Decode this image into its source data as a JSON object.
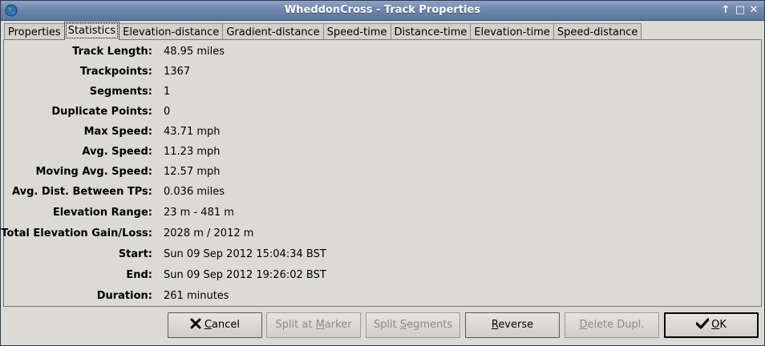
{
  "window": {
    "title": "WheddonCross - Track Properties",
    "controls": [
      "↑",
      "□",
      "✕"
    ]
  },
  "tabs": [
    {
      "label": "Properties"
    },
    {
      "label": "Statistics"
    },
    {
      "label": "Elevation-distance"
    },
    {
      "label": "Gradient-distance"
    },
    {
      "label": "Speed-time"
    },
    {
      "label": "Distance-time"
    },
    {
      "label": "Elevation-time"
    },
    {
      "label": "Speed-distance"
    }
  ],
  "active_tab": "Statistics",
  "stats": [
    {
      "label": "Track Length:",
      "value": "48.95 miles"
    },
    {
      "label": "Trackpoints:",
      "value": "1367"
    },
    {
      "label": "Segments:",
      "value": "1"
    },
    {
      "label": "Duplicate Points:",
      "value": "0"
    },
    {
      "label": "Max Speed:",
      "value": "43.71 mph"
    },
    {
      "label": "Avg. Speed:",
      "value": "11.23 mph"
    },
    {
      "label": "Moving Avg. Speed:",
      "value": "12.57 mph"
    },
    {
      "label": "Avg. Dist. Between TPs:",
      "value": "0.036 miles"
    },
    {
      "label": "Elevation Range:",
      "value": "23 m - 481 m"
    },
    {
      "label": "Total Elevation Gain/Loss:",
      "value": "2028 m / 2012 m"
    },
    {
      "label": "Start:",
      "value": "Sun 09 Sep 2012 15:04:34 BST"
    },
    {
      "label": "End:",
      "value": "Sun 09 Sep 2012 19:26:02 BST"
    },
    {
      "label": "Duration:",
      "value": "261 minutes"
    }
  ],
  "buttons": {
    "cancel": {
      "pre": "",
      "mn": "C",
      "post": "ancel",
      "icon": "x-icon",
      "enabled": true
    },
    "split_marker": {
      "pre": "Split at ",
      "mn": "M",
      "post": "arker",
      "enabled": false
    },
    "split_segments": {
      "pre": "Split ",
      "mn": "S",
      "post": "egments",
      "enabled": false
    },
    "reverse": {
      "pre": "",
      "mn": "R",
      "post": "everse",
      "enabled": true
    },
    "delete_dupl": {
      "pre": "",
      "mn": "D",
      "post": "elete Dupl.",
      "enabled": false
    },
    "ok": {
      "pre": "",
      "mn": "O",
      "post": "K",
      "icon": "checkmark-icon",
      "enabled": true
    }
  }
}
